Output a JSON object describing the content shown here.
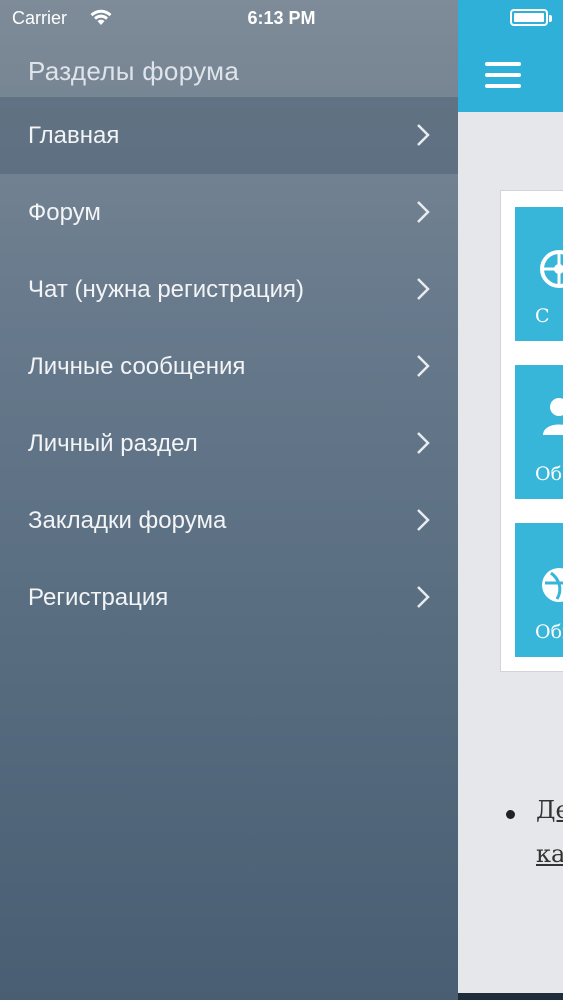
{
  "status_bar": {
    "carrier": "Carrier",
    "time": "6:13 PM"
  },
  "sidebar": {
    "title": "Разделы форума",
    "items": [
      {
        "label": "Главная",
        "active": true
      },
      {
        "label": "Форум"
      },
      {
        "label": "Чат (нужна регистрация)"
      },
      {
        "label": "Личные сообщения"
      },
      {
        "label": "Личный раздел"
      },
      {
        "label": "Закладки форума"
      },
      {
        "label": "Регистрация"
      }
    ]
  },
  "content": {
    "accent_color": "#2fb0d9",
    "tiles": [
      {
        "label": "С",
        "icon": "wheel-icon"
      },
      {
        "label": "Об",
        "icon": "people-icon"
      },
      {
        "label": "Обн",
        "icon": "globe-icon"
      }
    ],
    "list_link": {
      "line1": "Де",
      "line2": "ка"
    }
  }
}
